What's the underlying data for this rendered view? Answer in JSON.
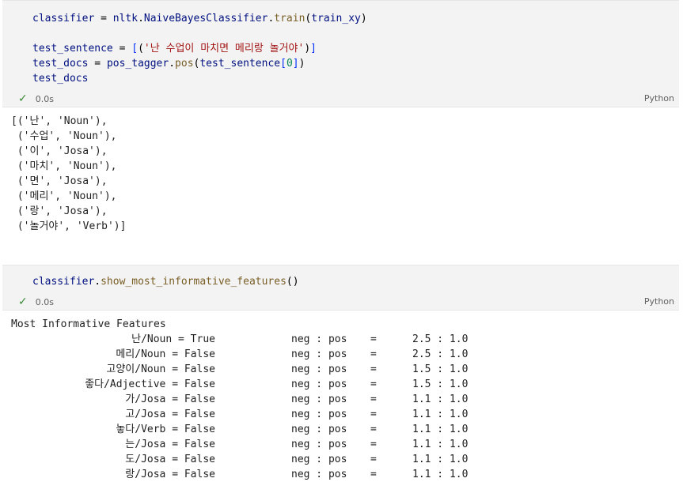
{
  "cell1": {
    "lines": [
      {
        "parts": [
          [
            "def",
            "classifier"
          ],
          [
            "op",
            " = "
          ],
          [
            "def",
            "nltk"
          ],
          [
            "op",
            "."
          ],
          [
            "def",
            "NaiveBayesClassifier"
          ],
          [
            "op",
            "."
          ],
          [
            "fn",
            "train"
          ],
          [
            "op",
            "("
          ],
          [
            "def",
            "train_xy"
          ],
          [
            "op",
            ")"
          ]
        ]
      },
      {
        "parts": [
          [
            "op",
            " "
          ]
        ]
      },
      {
        "parts": [
          [
            "def",
            "test_sentence"
          ],
          [
            "op",
            " = "
          ],
          [
            "brk",
            "["
          ],
          [
            "op",
            "("
          ],
          [
            "str",
            "'난 수업이 마치면 메리랑 놀거야'"
          ],
          [
            "op",
            ")"
          ],
          [
            "brk",
            "]"
          ]
        ]
      },
      {
        "parts": [
          [
            "def",
            "test_docs"
          ],
          [
            "op",
            " = "
          ],
          [
            "def",
            "pos_tagger"
          ],
          [
            "op",
            "."
          ],
          [
            "fn",
            "pos"
          ],
          [
            "op",
            "("
          ],
          [
            "def",
            "test_sentence"
          ],
          [
            "brk",
            "["
          ],
          [
            "num",
            "0"
          ],
          [
            "brk",
            "]"
          ],
          [
            "op",
            ")"
          ]
        ]
      },
      {
        "parts": [
          [
            "def",
            "test_docs"
          ]
        ]
      }
    ],
    "time": "0.0s",
    "lang": "Python"
  },
  "output1": [
    "[('난', 'Noun'),",
    " ('수업', 'Noun'),",
    " ('이', 'Josa'),",
    " ('마치', 'Noun'),",
    " ('면', 'Josa'),",
    " ('메리', 'Noun'),",
    " ('랑', 'Josa'),",
    " ('놀거야', 'Verb')]"
  ],
  "cell2": {
    "lines": [
      {
        "parts": [
          [
            "def",
            "classifier"
          ],
          [
            "op",
            "."
          ],
          [
            "fn",
            "show_most_informative_features"
          ],
          [
            "op",
            "()"
          ]
        ]
      }
    ],
    "time": "0.0s",
    "lang": "Python"
  },
  "output2": {
    "header": "Most Informative Features",
    "rows": [
      {
        "feature": "난/Noun = True",
        "labels": "neg : pos",
        "eq": "=",
        "ratio": "2.5 : 1.0"
      },
      {
        "feature": "메리/Noun = False",
        "labels": "neg : pos",
        "eq": "=",
        "ratio": "2.5 : 1.0"
      },
      {
        "feature": "고양이/Noun = False",
        "labels": "neg : pos",
        "eq": "=",
        "ratio": "1.5 : 1.0"
      },
      {
        "feature": "좋다/Adjective = False",
        "labels": "neg : pos",
        "eq": "=",
        "ratio": "1.5 : 1.0"
      },
      {
        "feature": "가/Josa = False",
        "labels": "neg : pos",
        "eq": "=",
        "ratio": "1.1 : 1.0"
      },
      {
        "feature": "고/Josa = False",
        "labels": "neg : pos",
        "eq": "=",
        "ratio": "1.1 : 1.0"
      },
      {
        "feature": "놓다/Verb = False",
        "labels": "neg : pos",
        "eq": "=",
        "ratio": "1.1 : 1.0"
      },
      {
        "feature": "는/Josa = False",
        "labels": "neg : pos",
        "eq": "=",
        "ratio": "1.1 : 1.0"
      },
      {
        "feature": "도/Josa = False",
        "labels": "neg : pos",
        "eq": "=",
        "ratio": "1.1 : 1.0"
      },
      {
        "feature": "랑/Josa = False",
        "labels": "neg : pos",
        "eq": "=",
        "ratio": "1.1 : 1.0"
      }
    ]
  }
}
